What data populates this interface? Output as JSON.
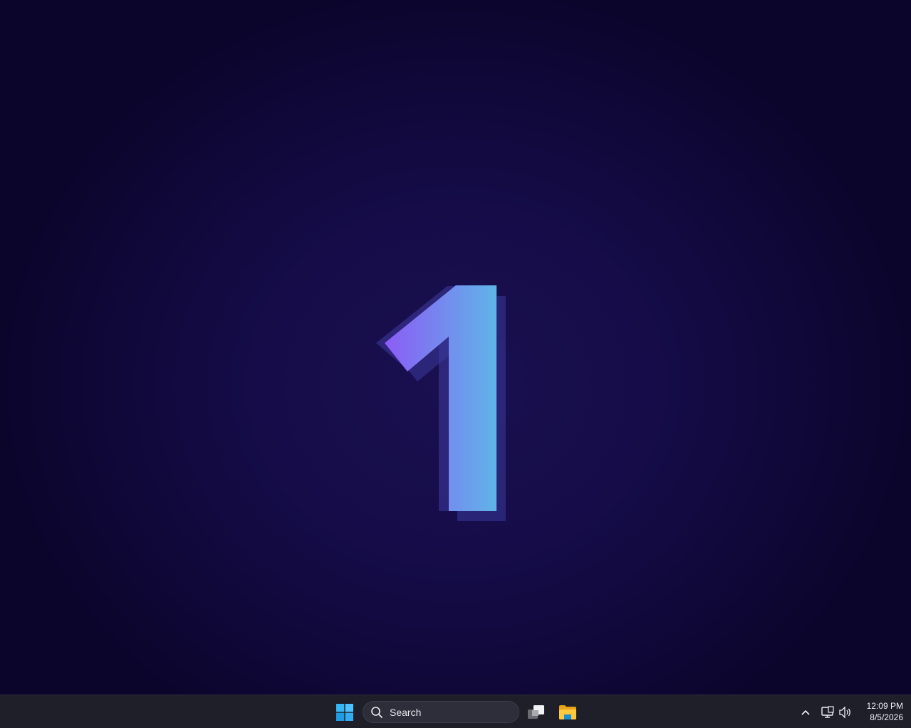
{
  "desktop": {
    "wallpaper": {
      "glyph": "1",
      "gradient_start": "#8b5cf6",
      "gradient_end": "#60b4e8",
      "background": "#150c48"
    }
  },
  "taskbar": {
    "start_icon": "windows-logo-icon",
    "search": {
      "icon": "search-icon",
      "placeholder": "Search"
    },
    "pinned": [
      {
        "name": "task-view",
        "icon": "task-view-icon"
      },
      {
        "name": "file-explorer",
        "icon": "folder-icon"
      }
    ],
    "tray": {
      "chevron_icon": "chevron-up-icon",
      "network_icon": "network-icon",
      "volume_icon": "volume-icon",
      "time": "12:09 PM",
      "date": "8/5/2026"
    }
  }
}
